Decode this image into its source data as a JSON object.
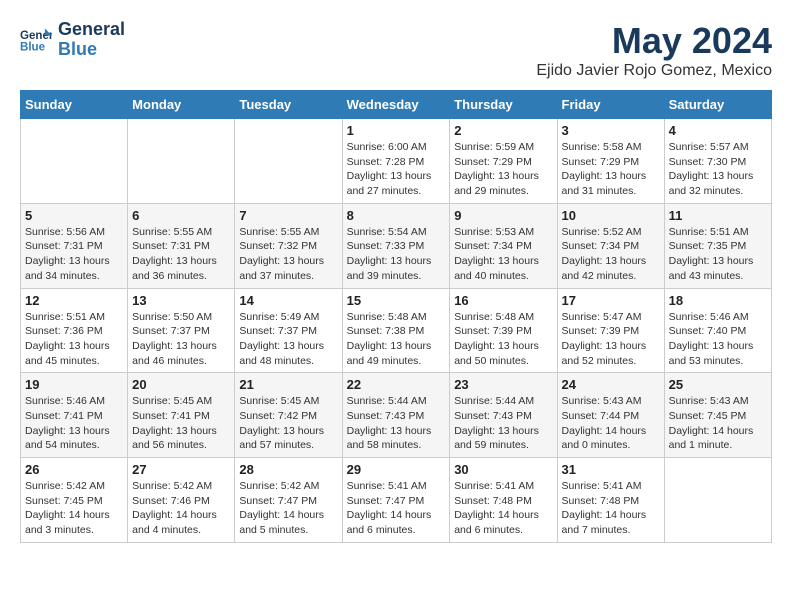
{
  "header": {
    "logo_line1": "General",
    "logo_line2": "Blue",
    "title": "May 2024",
    "subtitle": "Ejido Javier Rojo Gomez, Mexico"
  },
  "days_of_week": [
    "Sunday",
    "Monday",
    "Tuesday",
    "Wednesday",
    "Thursday",
    "Friday",
    "Saturday"
  ],
  "weeks": [
    [
      {
        "day": "",
        "info": ""
      },
      {
        "day": "",
        "info": ""
      },
      {
        "day": "",
        "info": ""
      },
      {
        "day": "1",
        "info": "Sunrise: 6:00 AM\nSunset: 7:28 PM\nDaylight: 13 hours and 27 minutes."
      },
      {
        "day": "2",
        "info": "Sunrise: 5:59 AM\nSunset: 7:29 PM\nDaylight: 13 hours and 29 minutes."
      },
      {
        "day": "3",
        "info": "Sunrise: 5:58 AM\nSunset: 7:29 PM\nDaylight: 13 hours and 31 minutes."
      },
      {
        "day": "4",
        "info": "Sunrise: 5:57 AM\nSunset: 7:30 PM\nDaylight: 13 hours and 32 minutes."
      }
    ],
    [
      {
        "day": "5",
        "info": "Sunrise: 5:56 AM\nSunset: 7:31 PM\nDaylight: 13 hours and 34 minutes."
      },
      {
        "day": "6",
        "info": "Sunrise: 5:55 AM\nSunset: 7:31 PM\nDaylight: 13 hours and 36 minutes."
      },
      {
        "day": "7",
        "info": "Sunrise: 5:55 AM\nSunset: 7:32 PM\nDaylight: 13 hours and 37 minutes."
      },
      {
        "day": "8",
        "info": "Sunrise: 5:54 AM\nSunset: 7:33 PM\nDaylight: 13 hours and 39 minutes."
      },
      {
        "day": "9",
        "info": "Sunrise: 5:53 AM\nSunset: 7:34 PM\nDaylight: 13 hours and 40 minutes."
      },
      {
        "day": "10",
        "info": "Sunrise: 5:52 AM\nSunset: 7:34 PM\nDaylight: 13 hours and 42 minutes."
      },
      {
        "day": "11",
        "info": "Sunrise: 5:51 AM\nSunset: 7:35 PM\nDaylight: 13 hours and 43 minutes."
      }
    ],
    [
      {
        "day": "12",
        "info": "Sunrise: 5:51 AM\nSunset: 7:36 PM\nDaylight: 13 hours and 45 minutes."
      },
      {
        "day": "13",
        "info": "Sunrise: 5:50 AM\nSunset: 7:37 PM\nDaylight: 13 hours and 46 minutes."
      },
      {
        "day": "14",
        "info": "Sunrise: 5:49 AM\nSunset: 7:37 PM\nDaylight: 13 hours and 48 minutes."
      },
      {
        "day": "15",
        "info": "Sunrise: 5:48 AM\nSunset: 7:38 PM\nDaylight: 13 hours and 49 minutes."
      },
      {
        "day": "16",
        "info": "Sunrise: 5:48 AM\nSunset: 7:39 PM\nDaylight: 13 hours and 50 minutes."
      },
      {
        "day": "17",
        "info": "Sunrise: 5:47 AM\nSunset: 7:39 PM\nDaylight: 13 hours and 52 minutes."
      },
      {
        "day": "18",
        "info": "Sunrise: 5:46 AM\nSunset: 7:40 PM\nDaylight: 13 hours and 53 minutes."
      }
    ],
    [
      {
        "day": "19",
        "info": "Sunrise: 5:46 AM\nSunset: 7:41 PM\nDaylight: 13 hours and 54 minutes."
      },
      {
        "day": "20",
        "info": "Sunrise: 5:45 AM\nSunset: 7:41 PM\nDaylight: 13 hours and 56 minutes."
      },
      {
        "day": "21",
        "info": "Sunrise: 5:45 AM\nSunset: 7:42 PM\nDaylight: 13 hours and 57 minutes."
      },
      {
        "day": "22",
        "info": "Sunrise: 5:44 AM\nSunset: 7:43 PM\nDaylight: 13 hours and 58 minutes."
      },
      {
        "day": "23",
        "info": "Sunrise: 5:44 AM\nSunset: 7:43 PM\nDaylight: 13 hours and 59 minutes."
      },
      {
        "day": "24",
        "info": "Sunrise: 5:43 AM\nSunset: 7:44 PM\nDaylight: 14 hours and 0 minutes."
      },
      {
        "day": "25",
        "info": "Sunrise: 5:43 AM\nSunset: 7:45 PM\nDaylight: 14 hours and 1 minute."
      }
    ],
    [
      {
        "day": "26",
        "info": "Sunrise: 5:42 AM\nSunset: 7:45 PM\nDaylight: 14 hours and 3 minutes."
      },
      {
        "day": "27",
        "info": "Sunrise: 5:42 AM\nSunset: 7:46 PM\nDaylight: 14 hours and 4 minutes."
      },
      {
        "day": "28",
        "info": "Sunrise: 5:42 AM\nSunset: 7:47 PM\nDaylight: 14 hours and 5 minutes."
      },
      {
        "day": "29",
        "info": "Sunrise: 5:41 AM\nSunset: 7:47 PM\nDaylight: 14 hours and 6 minutes."
      },
      {
        "day": "30",
        "info": "Sunrise: 5:41 AM\nSunset: 7:48 PM\nDaylight: 14 hours and 6 minutes."
      },
      {
        "day": "31",
        "info": "Sunrise: 5:41 AM\nSunset: 7:48 PM\nDaylight: 14 hours and 7 minutes."
      },
      {
        "day": "",
        "info": ""
      }
    ]
  ]
}
